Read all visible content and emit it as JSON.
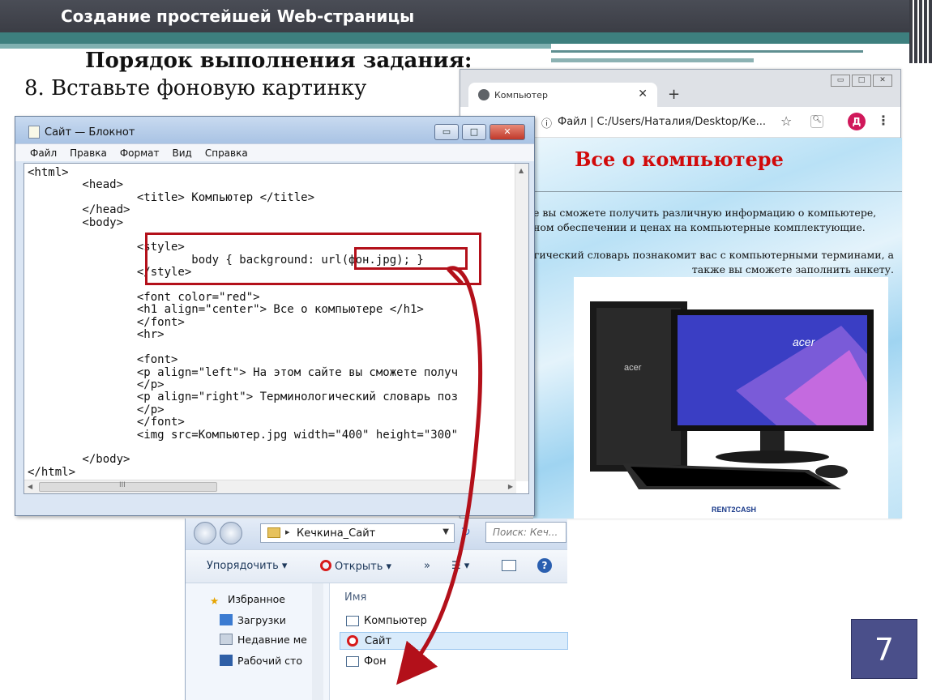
{
  "slide": {
    "title": "Создание простейшей Web-страницы",
    "subtitle": "Порядок выполнения задания:",
    "step": "8. Вставьте фоновую картинку",
    "page_number": "7"
  },
  "notepad": {
    "title": "Сайт — Блокнот",
    "menu": [
      "Файл",
      "Правка",
      "Формат",
      "Вид",
      "Справка"
    ],
    "code_lines": [
      "<html>",
      "        <head>",
      "                <title> Компьютер </title>",
      "        </head>",
      "        <body>",
      "",
      "                <style>",
      "                        body { background: url(фон.jpg); }",
      "                </style>",
      "",
      "                <font color=\"red\">",
      "                <h1 align=\"center\"> Все о компьютере </h1>",
      "                </font>",
      "                <hr>",
      "",
      "                <font>",
      "                <p align=\"left\"> На этом сайте вы сможете получ",
      "                </p>",
      "                <p align=\"right\"> Терминологический словарь поз",
      "                </p>",
      "                </font>",
      "                <img src=Компьютер.jpg width=\"400\" height=\"300\"",
      "",
      "        </body>",
      "</html>"
    ],
    "hscroll_label": "III"
  },
  "browser": {
    "tab_title": "Компьютер",
    "new_tab": "+",
    "address": "Файл  |  C:/Users/Наталия/Desktop/Ке...",
    "avatar_letter": "Д",
    "page": {
      "heading": "Все о компьютере",
      "paragraph_left": "е вы сможете получить различную информацию о компьютере,\nном обеспечении и ценах на компьютерные комплектующие.",
      "paragraph_right": "гический словарь познакомит вас с компьютерными терминами, а\nтакже вы сможете заполнить анкету.",
      "image_brand": "acer",
      "image_logo": "RENT2CASH"
    }
  },
  "explorer": {
    "path": "Кечкина_Сайт",
    "search_placeholder": "Поиск: Кеч...",
    "toolbar": {
      "organize": "Упорядочить ▾",
      "open": "Открыть ▾",
      "more": "»"
    },
    "nav": [
      "Избранное",
      "Загрузки",
      "Недавние ме",
      "Рабочий сто"
    ],
    "column_header": "Имя",
    "files": [
      {
        "name": "Компьютер",
        "icon": "image-file-icon"
      },
      {
        "name": "Сайт",
        "icon": "opera-html-icon"
      },
      {
        "name": "Фон",
        "icon": "image-file-icon"
      }
    ]
  },
  "colors": {
    "header_bg": "#3b3d45",
    "teal": "#3d7f7e",
    "highlight_red": "#b3101a",
    "heading_red": "#d10a0a",
    "page_num_bg": "#4a4f8a"
  }
}
